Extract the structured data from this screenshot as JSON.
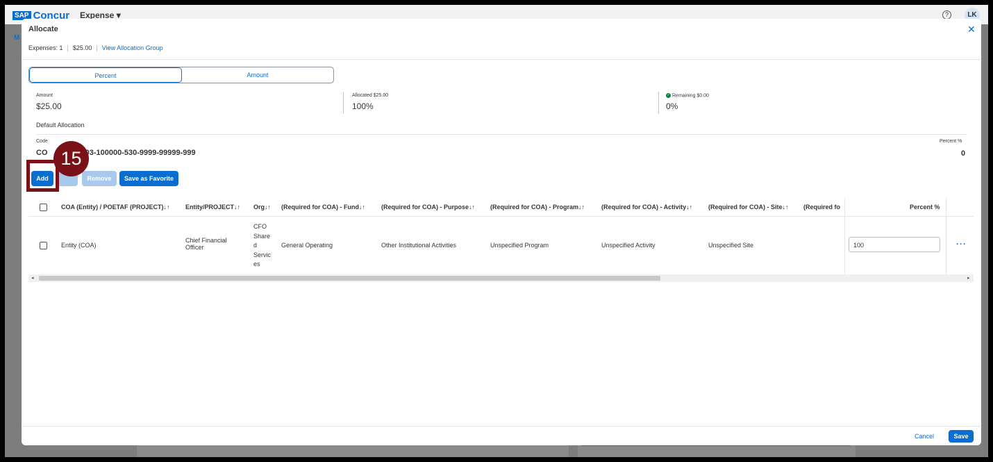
{
  "app": {
    "logo_badge": "SAP",
    "logo_text": "Concur",
    "menu": "Expense",
    "avatar": "LK",
    "bg_tab": "M"
  },
  "dialog": {
    "title": "Allocate",
    "meta": {
      "expenses": "Expenses: 1",
      "amount": "$25.00",
      "link": "View Allocation Group"
    },
    "segmented": {
      "options": [
        "Percent",
        "Amount"
      ],
      "selected": "Percent"
    },
    "summary": {
      "amount_label": "Amount",
      "amount_value": "$25.00",
      "allocated_label": "Allocated $25.00",
      "allocated_value": "100%",
      "remaining_label": "Remaining $0.00",
      "remaining_value": "0%"
    },
    "default_allocation": {
      "title": "Default Allocation",
      "code_label": "Code",
      "code_value": "CO",
      "code_value_tail": "003-100000-530-9999-99999-999",
      "percent_label": "Percent %",
      "percent_value": "0"
    },
    "buttons": {
      "add": "Add",
      "hidden": "",
      "remove": "Remove",
      "favorite": "Save as Favorite"
    },
    "callout": {
      "number": "15"
    },
    "table": {
      "columns": [
        "COA (Entity) / POETAF (PROJECT)↓↑",
        "Entity/PROJECT↓↑",
        "Org↓↑",
        "(Required for COA) - Fund↓↑",
        "(Required for COA) - Purpose↓↑",
        "(Required for COA) - Program↓↑",
        "(Required for COA) - Activity↓↑",
        "(Required for COA) - Site↓↑",
        "(Required fo",
        "Percent %"
      ],
      "row": {
        "coa": "Entity (COA)",
        "entity_line1": "Chief Financial",
        "entity_line2": "Officer",
        "org_lines": [
          "CFO",
          "Share",
          "d",
          "Servic",
          "es"
        ],
        "fund": "General Operating",
        "purpose": "Other Institutional Activities",
        "program": "Unspecified Program",
        "activity": "Unspecified Activity",
        "site": "Unspecified Site",
        "percent": "100"
      }
    },
    "footer": {
      "cancel": "Cancel",
      "save": "Save"
    }
  }
}
